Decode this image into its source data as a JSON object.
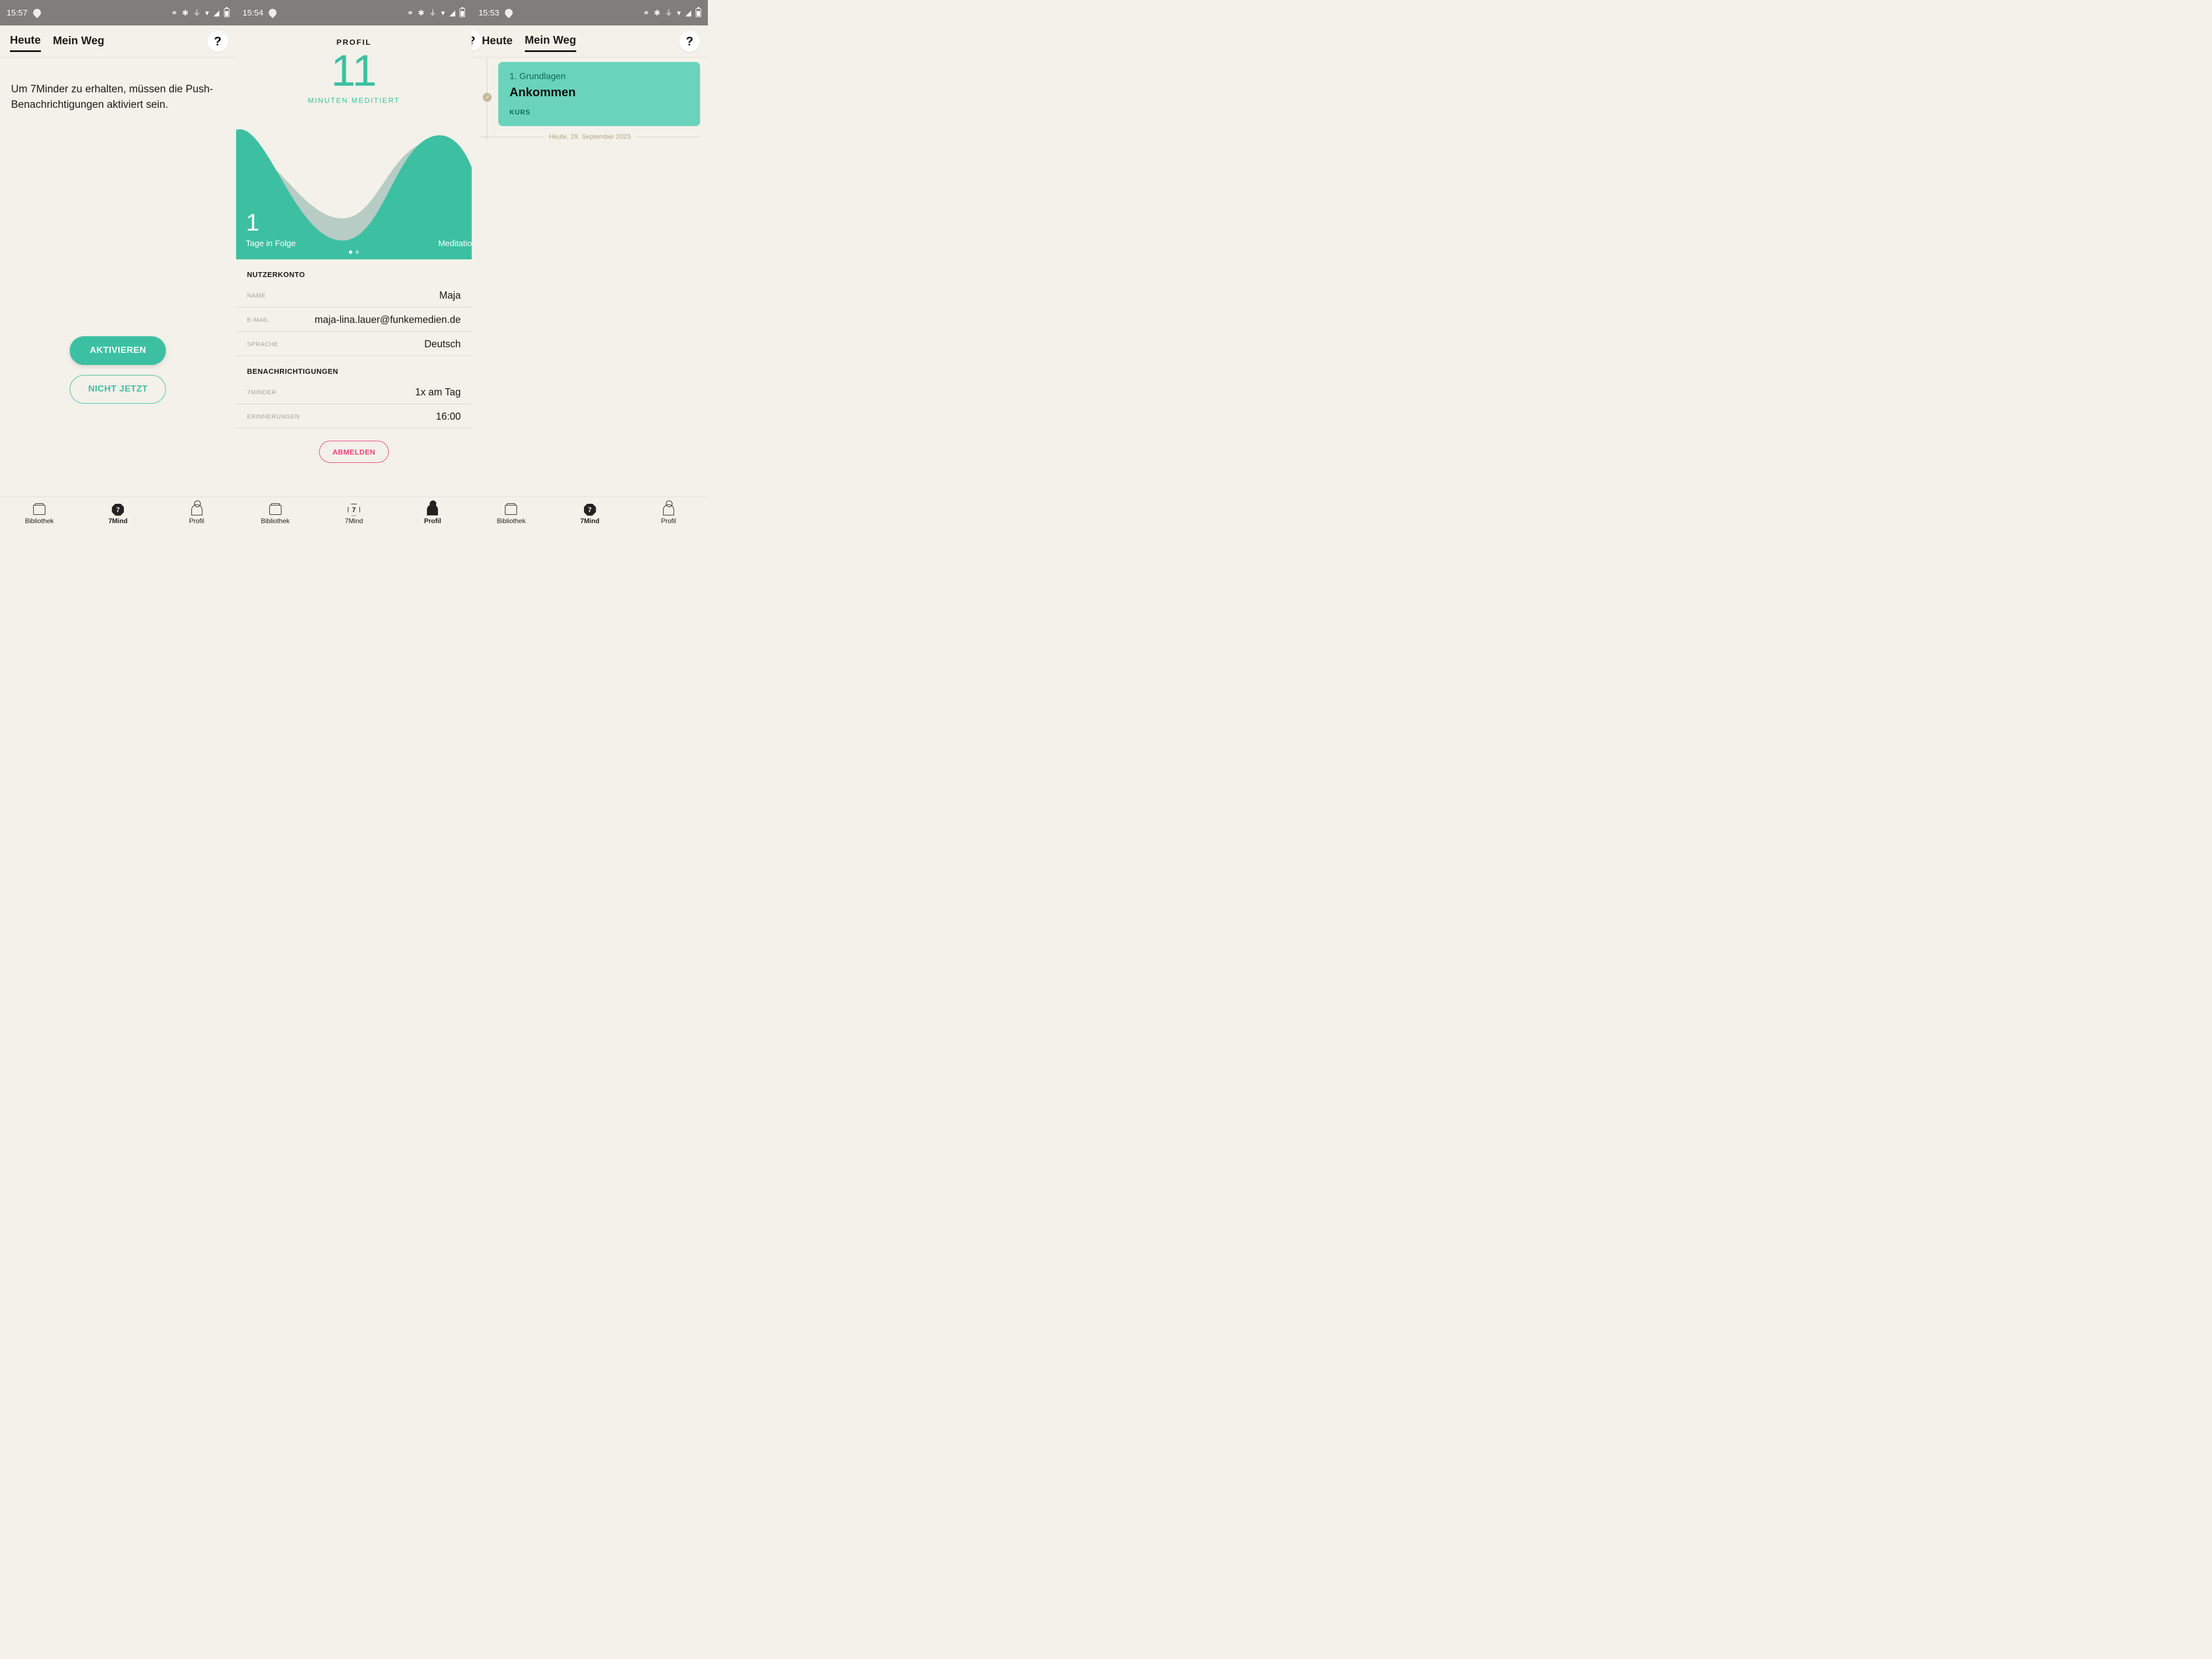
{
  "status": {
    "times": [
      "15:57",
      "15:54",
      "15:53"
    ]
  },
  "col1": {
    "tabs": {
      "heute": "Heute",
      "meinweg": "Mein Weg"
    },
    "help": "?",
    "body": "Um 7Minder zu erhalten, müssen die Push-Benachrichtigungen aktiviert sein.",
    "btn_activate": "AKTIVIEREN",
    "btn_not_now": "NICHT JETZT"
  },
  "col2": {
    "title": "PROFIL",
    "big_number": "11",
    "big_label": "MINUTEN MEDITIERT",
    "streak_num": "1",
    "streak_lbl": "Tage in Folge",
    "right_lbl": "Meditatio",
    "sec_account": "NUTZERKONTO",
    "rows": {
      "name_lbl": "NAME",
      "name_val": "Maja",
      "email_lbl": "E-MAIL",
      "email_val": "maja-lina.lauer@funkemedien.de",
      "lang_lbl": "SPRACHE",
      "lang_val": "Deutsch"
    },
    "sec_notif": "BENACHRICHTIGUNGEN",
    "notif": {
      "minder_lbl": "7MINDER",
      "minder_val": "1x am Tag",
      "remind_lbl": "ERINNERUNGEN",
      "remind_val": "16:00"
    },
    "logout": "ABMELDEN"
  },
  "col3": {
    "tabs": {
      "heute": "Heute",
      "meinweg": "Mein Weg"
    },
    "help": "?",
    "card": {
      "chapter": "1. Grundlagen",
      "title": "Ankommen",
      "kind": "KURS"
    },
    "date": "Heute, 29. September 2023"
  },
  "nav": {
    "lib": "Bibliothek",
    "mind": "7Mind",
    "profil": "Profil"
  }
}
